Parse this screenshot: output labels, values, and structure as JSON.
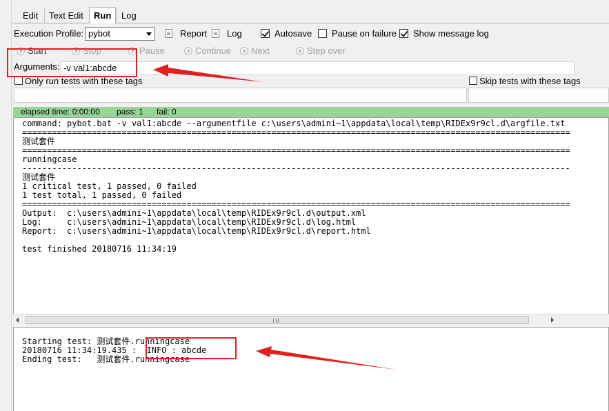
{
  "tabs": [
    {
      "label": "Edit",
      "active": false
    },
    {
      "label": "Text Edit",
      "active": false
    },
    {
      "label": "Run",
      "active": true
    },
    {
      "label": "Log",
      "active": false
    }
  ],
  "profile": {
    "label": "Execution Profile:",
    "value": "pybot",
    "report_label": "Report",
    "log_label": "Log",
    "autosave_label": "Autosave",
    "autosave_checked": true,
    "pause_on_failure_label": "Pause on failure",
    "pause_on_failure_checked": false,
    "show_message_log_label": "Show message log",
    "show_message_log_checked": true
  },
  "controls": {
    "start": "Start",
    "stop": "Stop",
    "pause": "Pause",
    "continue": "Continue",
    "next": "Next",
    "step_over": "Step over"
  },
  "arguments": {
    "label": "Arguments:",
    "value": "-v val1:abcde"
  },
  "tags": {
    "only_run_label": "Only run tests with these tags",
    "only_run_value": "",
    "skip_label": "Skip tests with these tags",
    "skip_value": ""
  },
  "status": {
    "elapsed": "elapsed time: 0:00:00",
    "pass": "pass: 1",
    "fail": "fail: 0",
    "color": "#98d698"
  },
  "console": {
    "lines": [
      "command: pybot.bat -v val1:abcde --argumentfile c:\\users\\admini~1\\appdata\\local\\temp\\RIDEx9r9cl.d\\argfile.txt",
      "==============================================================================================================",
      "测试套件",
      "==============================================================================================================",
      "runningcase",
      "--------------------------------------------------------------------------------------------------------------",
      "测试套件",
      "1 critical test, 1 passed, 0 failed",
      "1 test total, 1 passed, 0 failed",
      "==============================================================================================================",
      "Output:  c:\\users\\admini~1\\appdata\\local\\temp\\RIDEx9r9cl.d\\output.xml",
      "Log:     c:\\users\\admini~1\\appdata\\local\\temp\\RIDEx9r9cl.d\\log.html",
      "Report:  c:\\users\\admini~1\\appdata\\local\\temp\\RIDEx9r9cl.d\\report.html",
      "",
      "test finished 20180716 11:34:19"
    ]
  },
  "message_log": {
    "lines": [
      "Starting test: 测试套件.runningcase",
      "20180716 11:34:19.435 :  INFO : abcde",
      "Ending test:   测试套件.runningcase"
    ]
  },
  "annotation_color": "#e02020"
}
